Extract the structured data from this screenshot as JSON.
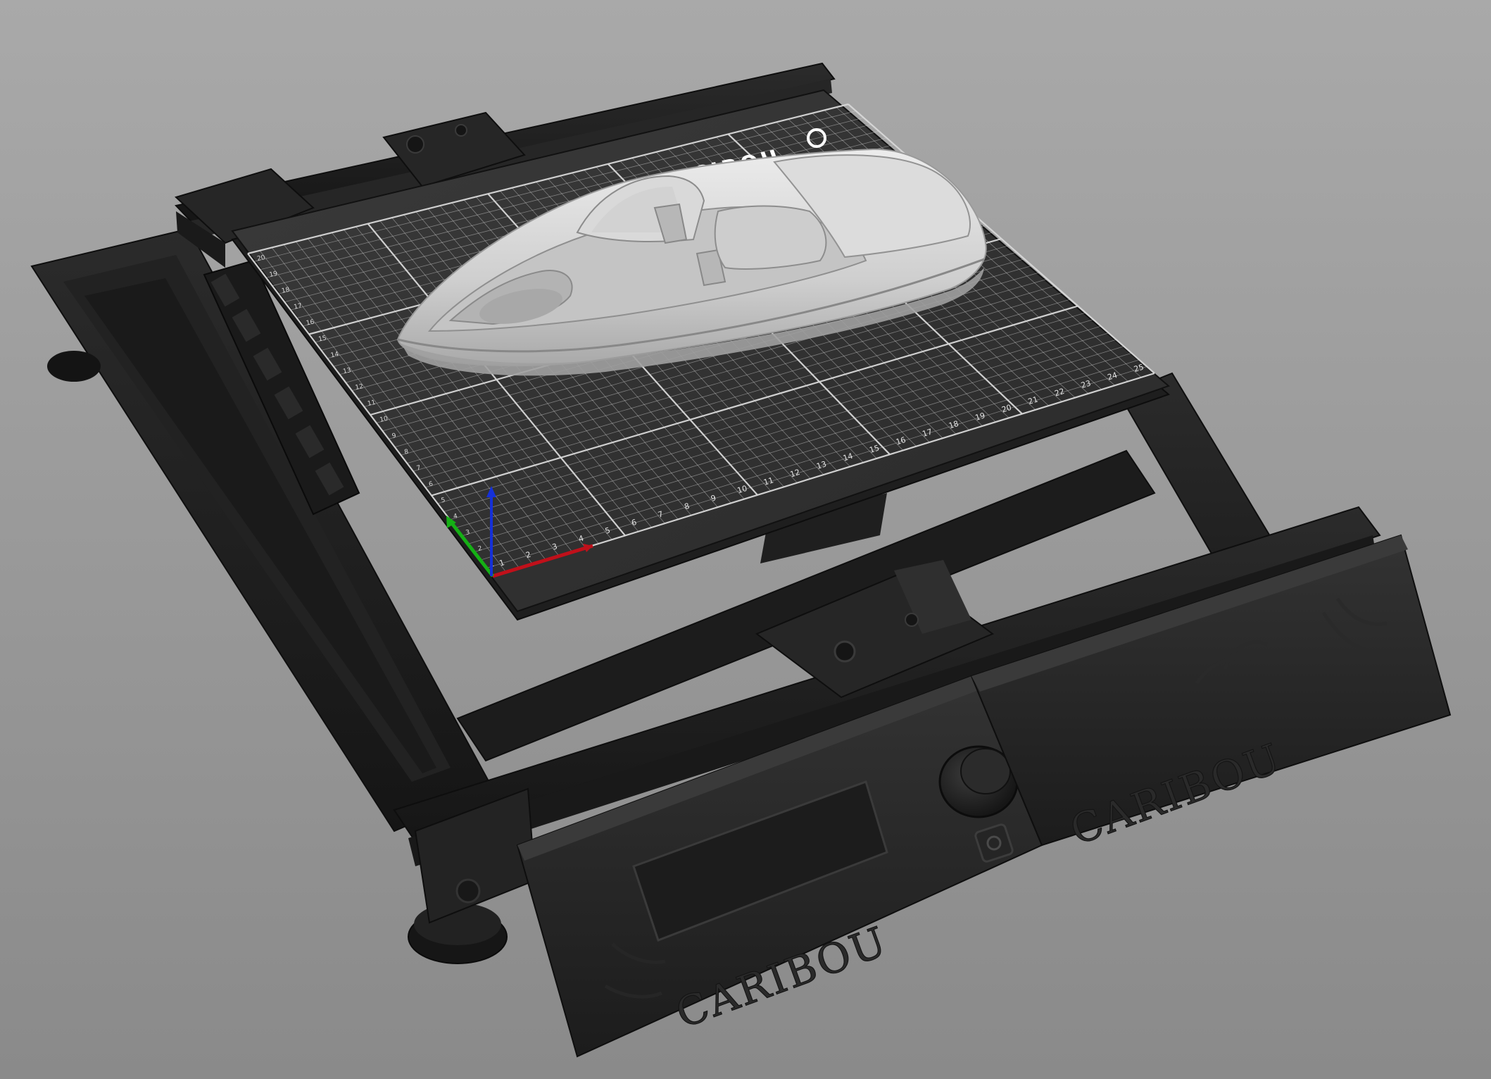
{
  "scene": {
    "type": "3d-printer-bed-preview",
    "background_top": "#a9a9a9",
    "background_bottom": "#8a8a8a",
    "bed_color": "#2e2e2e",
    "grid_color": "#d8d8d8",
    "frame_color": "#1f1f1f",
    "model_color": "#d0d0d0"
  },
  "bed": {
    "x_ticks": [
      "1",
      "2",
      "3",
      "4",
      "5",
      "6",
      "7",
      "8",
      "9",
      "10",
      "11",
      "12",
      "13",
      "14",
      "15",
      "16",
      "17",
      "18",
      "19",
      "20",
      "21",
      "22",
      "23",
      "24",
      "25"
    ],
    "y_ticks": [
      "1",
      "2",
      "3",
      "4",
      "5",
      "6",
      "7",
      "8",
      "9",
      "10",
      "11",
      "12",
      "13",
      "14",
      "15",
      "16",
      "17",
      "18",
      "19",
      "20"
    ],
    "logo_text": "CIBOU"
  },
  "axes": {
    "x_color": "#c0101a",
    "y_color": "#15b015",
    "z_color": "#1530d8"
  },
  "branding": {
    "left_panel_text": "CARIBOU",
    "right_panel_text": "CARIBOU"
  }
}
